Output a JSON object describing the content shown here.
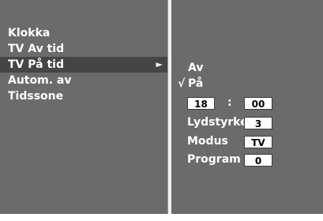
{
  "menu": {
    "items": [
      {
        "label": "Klokka"
      },
      {
        "label": "TV Av tid"
      },
      {
        "label": "TV På tid",
        "selected": true
      },
      {
        "label": "Autom. av"
      },
      {
        "label": "Tidssone"
      }
    ],
    "submenu_indicator": "►"
  },
  "submenu": {
    "options": [
      {
        "label": "Av"
      },
      {
        "label": "På",
        "checked": true
      }
    ],
    "check_mark": "√",
    "time": {
      "hour": "18",
      "separator": ":",
      "minute": "00"
    },
    "fields": [
      {
        "label": "Lydstyrke",
        "value": "3"
      },
      {
        "label": "Modus",
        "value": "TV"
      },
      {
        "label": "Program",
        "value": "0"
      }
    ]
  }
}
